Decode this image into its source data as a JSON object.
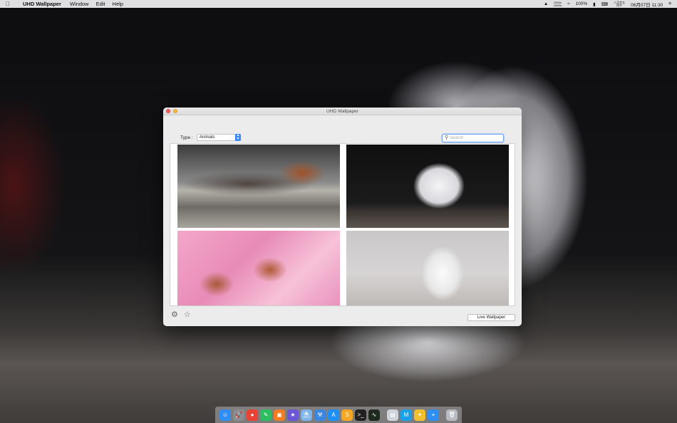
{
  "menubar": {
    "app_name": "UHD Wallpaper",
    "menus": [
      "Window",
      "Edit",
      "Help"
    ],
    "status_net_up": "0KB/s",
    "status_net_down": "0KB/s",
    "battery": "100%",
    "lunar_top": "八月廿五",
    "lunar_bottom": "丙午",
    "clock": "06月07日 11:30"
  },
  "window": {
    "title": "UHD Wallpaper",
    "type_label": "Type :",
    "type_selected": "Animals",
    "search_placeholder": "Search",
    "search_value": "",
    "thumbnails": [
      {
        "subject": "duck-with-ducklings"
      },
      {
        "subject": "white-kitten"
      },
      {
        "subject": "birds-on-cherry-blossom"
      },
      {
        "subject": "white-dog"
      }
    ],
    "live_button": "Live Wallpaper"
  },
  "dock": {
    "apps": [
      {
        "name": "finder-icon",
        "color": "#2f8df5",
        "glyph": "☺"
      },
      {
        "name": "launchpad-icon",
        "color": "#8c8c90",
        "glyph": "🚀"
      },
      {
        "name": "chrome-icon",
        "color": "#e94235",
        "glyph": "●"
      },
      {
        "name": "evernote-icon",
        "color": "#2dbe60",
        "glyph": "✎"
      },
      {
        "name": "books-icon",
        "color": "#f27c22",
        "glyph": "▣"
      },
      {
        "name": "star-app-icon",
        "color": "#6b56d6",
        "glyph": "★"
      },
      {
        "name": "preview-icon",
        "color": "#7fb4e8",
        "glyph": "⛱"
      },
      {
        "name": "xcode-icon",
        "color": "#3a86e0",
        "glyph": "⚒"
      },
      {
        "name": "app-store-icon",
        "color": "#1e90f5",
        "glyph": "A"
      },
      {
        "name": "sublime-icon",
        "color": "#f5a623",
        "glyph": "S"
      },
      {
        "name": "terminal-icon",
        "color": "#222222",
        "glyph": ">_"
      },
      {
        "name": "activity-monitor-icon",
        "color": "#1f2a1f",
        "glyph": "∿"
      },
      {
        "name": "file-icon",
        "color": "#cfd4dc",
        "glyph": "▤"
      },
      {
        "name": "markdown-icon",
        "color": "#1aa0e8",
        "glyph": "M"
      },
      {
        "name": "pinwheel-icon",
        "color": "#f0c030",
        "glyph": "✦"
      },
      {
        "name": "safari-icon",
        "color": "#2e8ef2",
        "glyph": "⌖"
      },
      {
        "name": "trash-icon",
        "color": "#b8bcc2",
        "glyph": "🗑"
      }
    ]
  }
}
